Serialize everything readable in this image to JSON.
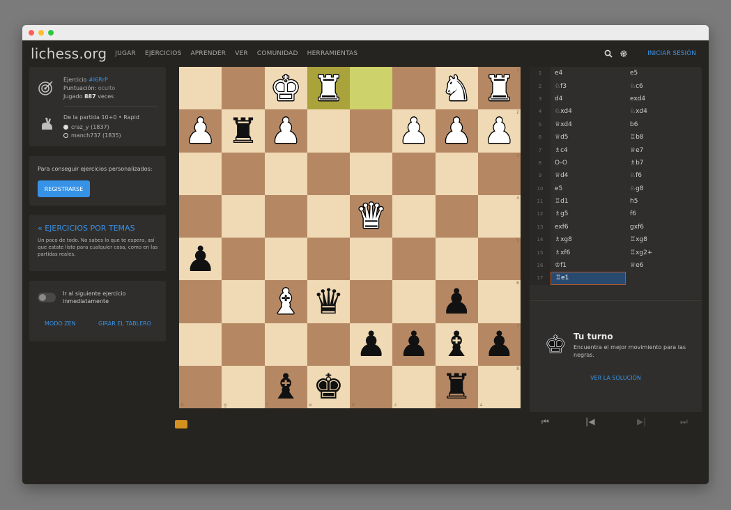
{
  "colors": {
    "accent": "#3692e7",
    "board_light": "#f0d9b5",
    "board_dark": "#b58863",
    "highlight": "#cdd26a"
  },
  "nav": {
    "logo": "lichess.org",
    "items": [
      "JUGAR",
      "EJERCICIOS",
      "APRENDER",
      "VER",
      "COMUNIDAD",
      "HERRAMIENTAS"
    ],
    "signin": "INICIAR SESIÓN",
    "icons": [
      "search-icon",
      "gear-icon"
    ]
  },
  "puzzle": {
    "title_prefix": "Ejercicio",
    "id": "#I6RrP",
    "rating_label": "Puntuación:",
    "rating_value": "oculto",
    "played_prefix": "Jugado",
    "played_count": "887",
    "played_suffix": "veces",
    "game_label": "De la partida 10+0 • Rapid",
    "player_white": "craz_y (1837)",
    "player_black": "manch737 (1835)"
  },
  "signup": {
    "text": "Para conseguir ejercicios personalizados:",
    "button": "REGISTRARSE"
  },
  "themes": {
    "title": "« EJERCICIOS POR TEMAS",
    "desc": "Un poco de todo. No sabes lo que te espera, así que estate listo para cualquier cosa, como en las partidas reales."
  },
  "settings": {
    "toggle_label": "Ir al siguiente ejercicio inmediatamente",
    "zen": "MODO ZEN",
    "flip": "GIRAR EL TABLERO"
  },
  "board": {
    "ranks": [
      "1",
      "2",
      "3",
      "4",
      "5",
      "6",
      "7",
      "8"
    ],
    "files": [
      "h",
      "g",
      "f",
      "e",
      "d",
      "c",
      "b",
      "a"
    ],
    "pieces": [
      [
        {
          "c": 2,
          "p": "♚",
          "w": true
        },
        {
          "c": 3,
          "p": "♜",
          "w": true
        },
        {
          "c": 6,
          "p": "♞",
          "w": true
        },
        {
          "c": 7,
          "p": "♜",
          "w": true
        }
      ],
      [
        {
          "c": 0,
          "p": "♟",
          "w": true
        },
        {
          "c": 1,
          "p": "♜",
          "w": false
        },
        {
          "c": 2,
          "p": "♟",
          "w": true
        },
        {
          "c": 5,
          "p": "♟",
          "w": true
        },
        {
          "c": 6,
          "p": "♟",
          "w": true
        },
        {
          "c": 7,
          "p": "♟",
          "w": true
        }
      ],
      [],
      [
        {
          "c": 4,
          "p": "♛",
          "w": true
        }
      ],
      [
        {
          "c": 0,
          "p": "♟",
          "w": false
        }
      ],
      [
        {
          "c": 2,
          "p": "♝",
          "w": true
        },
        {
          "c": 3,
          "p": "♛",
          "w": false
        },
        {
          "c": 6,
          "p": "♟",
          "w": false
        }
      ],
      [
        {
          "c": 4,
          "p": "♟",
          "w": false
        },
        {
          "c": 5,
          "p": "♟",
          "w": false
        },
        {
          "c": 6,
          "p": "♝",
          "w": false
        },
        {
          "c": 7,
          "p": "♟",
          "w": false
        }
      ],
      [
        {
          "c": 2,
          "p": "♝",
          "w": false
        },
        {
          "c": 3,
          "p": "♚",
          "w": false
        },
        {
          "c": 6,
          "p": "♜",
          "w": false
        }
      ]
    ],
    "highlights": [
      {
        "r": 0,
        "c": 3,
        "cls": "hl2"
      },
      {
        "r": 0,
        "c": 4,
        "cls": "hl"
      }
    ]
  },
  "moves": [
    [
      "e4",
      "e5"
    ],
    [
      "♘f3",
      "♘c6"
    ],
    [
      "d4",
      "exd4"
    ],
    [
      "♘xd4",
      "♘xd4"
    ],
    [
      "♕xd4",
      "b6"
    ],
    [
      "♕d5",
      "♖b8"
    ],
    [
      "♗c4",
      "♕e7"
    ],
    [
      "O-O",
      "♗b7"
    ],
    [
      "♕d4",
      "♘f6"
    ],
    [
      "e5",
      "♘g8"
    ],
    [
      "♖d1",
      "h5"
    ],
    [
      "♗g5",
      "f6"
    ],
    [
      "exf6",
      "gxf6"
    ],
    [
      "♗xg8",
      "♖xg8"
    ],
    [
      "♗xf6",
      "♖xg2+"
    ],
    [
      "♔f1",
      "♕e6"
    ],
    [
      "♖e1",
      ""
    ]
  ],
  "active_move": "17w",
  "turn": {
    "title": "Tu turno",
    "desc": "Encuentra el mejor movimiento para las negras.",
    "solution": "VER LA SOLUCIÓN"
  }
}
